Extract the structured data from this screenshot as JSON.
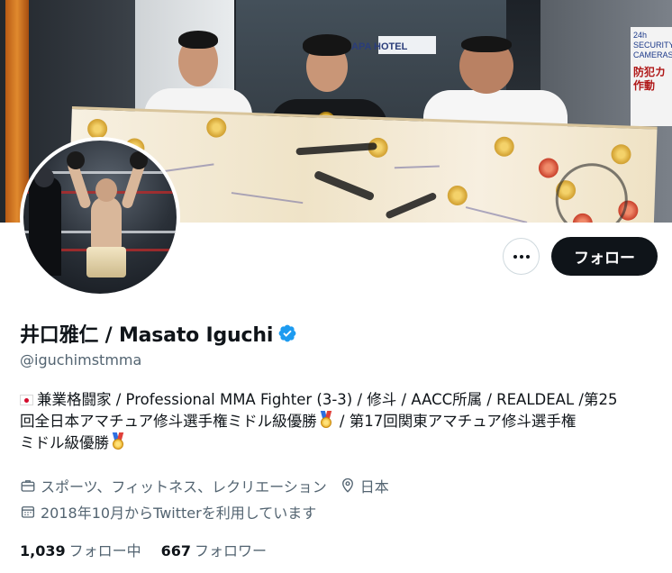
{
  "banner": {
    "hotel_sign": "APA HOTEL",
    "camera_sign_en": "24h SECURITY CAMERAS",
    "camera_sign_jp": "防犯カ 作動"
  },
  "profile": {
    "display_name": "井口雅仁 / Masato Iguchi",
    "handle": "@iguchimstmma",
    "verified": true,
    "bio_lines": [
      "兼業格闘家 / Professional MMA Fighter (3-3) / 修斗 / AACC所属 / REALDEAL /第25",
      "回全日本アマチュア修斗選手権ミドル級優勝",
      " / 第17回関東アマチュア修斗選手権",
      "ミドル級優勝"
    ],
    "category": "スポーツ、フィットネス、レクリエーション",
    "location": "日本",
    "joined": "2018年10月からTwitterを利用しています"
  },
  "actions": {
    "follow_label": "フォロー",
    "more_label": "More"
  },
  "stats": {
    "following_count": "1,039",
    "following_label": "フォロー中",
    "followers_count": "667",
    "followers_label": "フォロワー"
  },
  "icons": {
    "more": "more-dots-icon",
    "verified": "verified-badge-icon",
    "category": "briefcase-icon",
    "location": "location-pin-icon",
    "joined": "calendar-icon",
    "bio_flag": "japan-flag-icon",
    "bio_medal": "gold-medal-icon"
  },
  "colors": {
    "text_primary": "#0f1419",
    "text_secondary": "#536471",
    "verified_blue": "#1d9bf0",
    "follow_button_bg": "#0f1419",
    "border": "#cfd9de"
  }
}
